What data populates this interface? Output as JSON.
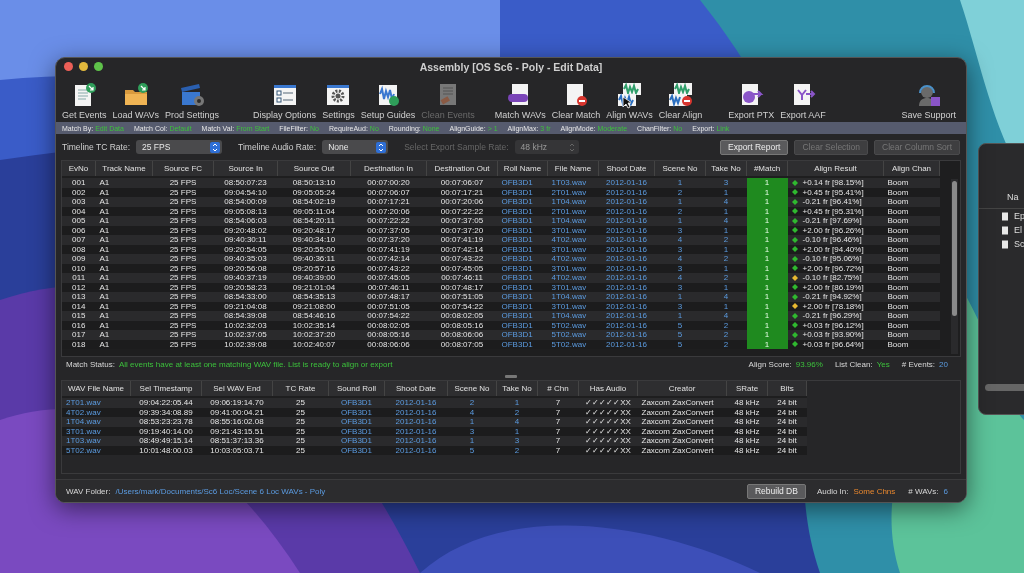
{
  "window": {
    "title": "Assembly [OS Sc6 - Poly - Edit Data]"
  },
  "toolbar": [
    {
      "label": "Get Events",
      "disabled": false
    },
    {
      "label": "Load WAVs",
      "disabled": false
    },
    {
      "label": "Prod Settings",
      "disabled": false
    },
    {
      "label": "Display Options",
      "disabled": false
    },
    {
      "label": "Settings",
      "disabled": false
    },
    {
      "label": "Setup Guides",
      "disabled": false
    },
    {
      "label": "Clean Events",
      "disabled": true
    },
    {
      "label": "Match WAVs",
      "disabled": false
    },
    {
      "label": "Clear Match",
      "disabled": false
    },
    {
      "label": "Align WAVs",
      "disabled": false
    },
    {
      "label": "Clear Align",
      "disabled": false
    },
    {
      "label": "Export PTX",
      "disabled": false
    },
    {
      "label": "Export AAF",
      "disabled": false
    },
    {
      "label": "Save Support",
      "disabled": false
    }
  ],
  "settings_bar": [
    {
      "label": "Match By:",
      "value": "Edit Data"
    },
    {
      "label": "Match Col:",
      "value": "Default"
    },
    {
      "label": "Match Val:",
      "value": "From Start"
    },
    {
      "label": "FileFilter:",
      "value": "No"
    },
    {
      "label": "RequireAud:",
      "value": "No"
    },
    {
      "label": "Rounding:",
      "value": "None"
    },
    {
      "label": "AlignGuide:",
      "value": "> 1"
    },
    {
      "label": "AlignMax:",
      "value": "3 fr"
    },
    {
      "label": "AlignMode:",
      "value": "Moderate"
    },
    {
      "label": "ChanFilter:",
      "value": "No"
    },
    {
      "label": "Export:",
      "value": "Link"
    }
  ],
  "selects": [
    {
      "label": "Timeline TC Rate:",
      "value": "25 FPS",
      "disabled": false
    },
    {
      "label": "Timeline Audio Rate:",
      "value": "None",
      "disabled": false
    },
    {
      "label": "Select Export Sample Rate:",
      "value": "48 kHz",
      "disabled": true
    }
  ],
  "buttons": [
    {
      "label": "Export Report",
      "disabled": false
    },
    {
      "label": "Clear Selection",
      "disabled": true
    },
    {
      "label": "Clear Column Sort",
      "disabled": true
    }
  ],
  "events_table": {
    "columns": [
      {
        "label": "EvNo",
        "kind": "center"
      },
      {
        "label": "Track Name",
        "kind": "text"
      },
      {
        "label": "Source FC",
        "kind": "center"
      },
      {
        "label": "Source In",
        "kind": "center"
      },
      {
        "label": "Source Out",
        "kind": "center"
      },
      {
        "label": "Destination In",
        "kind": "center"
      },
      {
        "label": "Destination Out",
        "kind": "center"
      },
      {
        "label": "Roll Name",
        "kind": "link"
      },
      {
        "label": "File Name",
        "kind": "link"
      },
      {
        "label": "Shoot Date",
        "kind": "link-center"
      },
      {
        "label": "Scene No",
        "kind": "link-center"
      },
      {
        "label": "Take No",
        "kind": "link-center"
      },
      {
        "label": "#Match",
        "kind": "match"
      },
      {
        "label": "Align Result",
        "kind": "result"
      },
      {
        "label": "Align Chan",
        "kind": "text"
      }
    ],
    "rows": [
      {
        "cells": [
          "001",
          "A1",
          "25 FPS",
          "08:50:07:23",
          "08:50:13:10",
          "00:07:00:20",
          "00:07:06:07",
          "OFB3D1",
          "1T03.wav",
          "2012-01-16",
          "1",
          "3",
          "1",
          "+0.14 fr [98.15%]",
          "Boom"
        ],
        "color": "#2fb82f"
      },
      {
        "cells": [
          "002",
          "A1",
          "25 FPS",
          "09:04:54:10",
          "09:05:05:24",
          "00:07:06:07",
          "00:07:17:21",
          "OFB3D1",
          "2T01.wav",
          "2012-01-16",
          "2",
          "1",
          "1",
          "+0.45 fr [95.41%]",
          "Boom"
        ],
        "color": "#2fb82f"
      },
      {
        "cells": [
          "003",
          "A1",
          "25 FPS",
          "08:54:00:09",
          "08:54:02:19",
          "00:07:17:21",
          "00:07:20:06",
          "OFB3D1",
          "1T04.wav",
          "2012-01-16",
          "1",
          "4",
          "1",
          "-0.21 fr [96.41%]",
          "Boom"
        ],
        "color": "#2fb82f"
      },
      {
        "cells": [
          "004",
          "A1",
          "25 FPS",
          "09:05:08:13",
          "09:05:11:04",
          "00:07:20:06",
          "00:07:22:22",
          "OFB3D1",
          "2T01.wav",
          "2012-01-16",
          "2",
          "1",
          "1",
          "+0.45 fr [95.31%]",
          "Boom"
        ],
        "color": "#2fb82f"
      },
      {
        "cells": [
          "005",
          "A1",
          "25 FPS",
          "08:54:06:03",
          "08:54:20:11",
          "00:07:22:22",
          "00:07:37:05",
          "OFB3D1",
          "1T04.wav",
          "2012-01-16",
          "1",
          "4",
          "1",
          "-0.21 fr [97.69%]",
          "Boom"
        ],
        "color": "#2fb82f"
      },
      {
        "cells": [
          "006",
          "A1",
          "25 FPS",
          "09:20:48:02",
          "09:20:48:17",
          "00:07:37:05",
          "00:07:37:20",
          "OFB3D1",
          "3T01.wav",
          "2012-01-16",
          "3",
          "1",
          "1",
          "+2.00 fr [96.26%]",
          "Boom"
        ],
        "color": "#2fb82f"
      },
      {
        "cells": [
          "007",
          "A1",
          "25 FPS",
          "09:40:30:11",
          "09:40:34:10",
          "00:07:37:20",
          "00:07:41:19",
          "OFB3D1",
          "4T02.wav",
          "2012-01-16",
          "4",
          "2",
          "1",
          "-0.10 fr [96.46%]",
          "Boom"
        ],
        "color": "#2fb82f"
      },
      {
        "cells": [
          "008",
          "A1",
          "25 FPS",
          "09:20:54:05",
          "09:20:55:00",
          "00:07:41:19",
          "00:07:42:14",
          "OFB3D1",
          "3T01.wav",
          "2012-01-16",
          "3",
          "1",
          "1",
          "+2.00 fr [94.40%]",
          "Boom"
        ],
        "color": "#2fb82f"
      },
      {
        "cells": [
          "009",
          "A1",
          "25 FPS",
          "09:40:35:03",
          "09:40:36:11",
          "00:07:42:14",
          "00:07:43:22",
          "OFB3D1",
          "4T02.wav",
          "2012-01-16",
          "4",
          "2",
          "1",
          "-0.10 fr [95.06%]",
          "Boom"
        ],
        "color": "#2fb82f"
      },
      {
        "cells": [
          "010",
          "A1",
          "25 FPS",
          "09:20:56:08",
          "09:20:57:16",
          "00:07:43:22",
          "00:07:45:05",
          "OFB3D1",
          "3T01.wav",
          "2012-01-16",
          "3",
          "1",
          "1",
          "+2.00 fr [96.72%]",
          "Boom"
        ],
        "color": "#2fb82f"
      },
      {
        "cells": [
          "011",
          "A1",
          "25 FPS",
          "09:40:37:19",
          "09:40:39:00",
          "00:07:45:05",
          "00:07:46:11",
          "OFB3D1",
          "4T02.wav",
          "2012-01-16",
          "4",
          "2",
          "1",
          "-0.10 fr [82.75%]",
          "Boom"
        ],
        "color": "#e8b830"
      },
      {
        "cells": [
          "012",
          "A1",
          "25 FPS",
          "09:20:58:23",
          "09:21:01:04",
          "00:07:46:11",
          "00:07:48:17",
          "OFB3D1",
          "3T01.wav",
          "2012-01-16",
          "3",
          "1",
          "1",
          "+2.00 fr [86.19%]",
          "Boom"
        ],
        "color": "#2fb82f"
      },
      {
        "cells": [
          "013",
          "A1",
          "25 FPS",
          "08:54:33:00",
          "08:54:35:13",
          "00:07:48:17",
          "00:07:51:05",
          "OFB3D1",
          "1T04.wav",
          "2012-01-16",
          "1",
          "4",
          "1",
          "-0.21 fr [94.92%]",
          "Boom"
        ],
        "color": "#2fb82f"
      },
      {
        "cells": [
          "014",
          "A1",
          "25 FPS",
          "09:21:04:08",
          "09:21:08:00",
          "00:07:51:05",
          "00:07:54:22",
          "OFB3D1",
          "3T01.wav",
          "2012-01-16",
          "3",
          "1",
          "1",
          "+2.00 fr [78.18%]",
          "Boom"
        ],
        "color": "#e8b830"
      },
      {
        "cells": [
          "015",
          "A1",
          "25 FPS",
          "08:54:39:08",
          "08:54:46:16",
          "00:07:54:22",
          "00:08:02:05",
          "OFB3D1",
          "1T04.wav",
          "2012-01-16",
          "1",
          "4",
          "1",
          "-0.21 fr [96.29%]",
          "Boom"
        ],
        "color": "#2fb82f"
      },
      {
        "cells": [
          "016",
          "A1",
          "25 FPS",
          "10:02:32:03",
          "10:02:35:14",
          "00:08:02:05",
          "00:08:05:16",
          "OFB3D1",
          "5T02.wav",
          "2012-01-16",
          "5",
          "2",
          "1",
          "+0.03 fr [96.12%]",
          "Boom"
        ],
        "color": "#2fb82f"
      },
      {
        "cells": [
          "017",
          "A1",
          "25 FPS",
          "10:02:37:05",
          "10:02:37:20",
          "00:08:05:16",
          "00:08:06:06",
          "OFB3D1",
          "5T02.wav",
          "2012-01-16",
          "5",
          "2",
          "1",
          "+0.03 fr [93.90%]",
          "Boom"
        ],
        "color": "#2fb82f"
      },
      {
        "cells": [
          "018",
          "A1",
          "25 FPS",
          "10:02:39:08",
          "10:02:40:07",
          "00:08:06:06",
          "00:08:07:05",
          "OFB3D1",
          "5T02.wav",
          "2012-01-16",
          "5",
          "2",
          "1",
          "+0.03 fr [96.64%]",
          "Boom"
        ],
        "color": "#2fb82f"
      }
    ]
  },
  "match_status": {
    "label": "Match Status:",
    "message": "All events have at least one matching WAV file. List is ready to align or export"
  },
  "summary": [
    {
      "label": "Align Score:",
      "value": "93.96%",
      "kind": "good"
    },
    {
      "label": "List Clean:",
      "value": "Yes",
      "kind": "good"
    },
    {
      "label": "# Events:",
      "value": "20",
      "kind": "info"
    }
  ],
  "wav_table": {
    "columns": [
      {
        "label": "WAV File Name",
        "kind": "link"
      },
      {
        "label": "Sel Timestamp",
        "kind": "center"
      },
      {
        "label": "Sel WAV End",
        "kind": "center"
      },
      {
        "label": "TC Rate",
        "kind": "center"
      },
      {
        "label": "Sound Roll",
        "kind": "link-center"
      },
      {
        "label": "Shoot Date",
        "kind": "link-center"
      },
      {
        "label": "Scene No",
        "kind": "link-center"
      },
      {
        "label": "Take No",
        "kind": "link-center"
      },
      {
        "label": "# Chn",
        "kind": "center"
      },
      {
        "label": "Has Audio",
        "kind": "center"
      },
      {
        "label": "Creator",
        "kind": "text"
      },
      {
        "label": "SRate",
        "kind": "center"
      },
      {
        "label": "Bits",
        "kind": "center"
      }
    ],
    "rows": [
      [
        "2T01.wav",
        "09:04:22:05.44",
        "09:06:19:14.70",
        "25",
        "OFB3D1",
        "2012-01-16",
        "2",
        "1",
        "7",
        "✓✓✓✓✓XX",
        "Zaxcom ZaxConvert",
        "48 kHz",
        "24 bit"
      ],
      [
        "4T02.wav",
        "09:39:34:08.89",
        "09:41:00:04.21",
        "25",
        "OFB3D1",
        "2012-01-16",
        "4",
        "2",
        "7",
        "✓✓✓✓✓XX",
        "Zaxcom ZaxConvert",
        "48 kHz",
        "24 bit"
      ],
      [
        "1T04.wav",
        "08:53:23:23.78",
        "08:55:16:02.08",
        "25",
        "OFB3D1",
        "2012-01-16",
        "1",
        "4",
        "7",
        "✓✓✓✓✓XX",
        "Zaxcom ZaxConvert",
        "48 kHz",
        "24 bit"
      ],
      [
        "3T01.wav",
        "09:19:40:14.00",
        "09:21:43:15.51",
        "25",
        "OFB3D1",
        "2012-01-16",
        "3",
        "1",
        "7",
        "✓✓✓✓✓XX",
        "Zaxcom ZaxConvert",
        "48 kHz",
        "24 bit"
      ],
      [
        "1T03.wav",
        "08:49:49:15.14",
        "08:51:37:13.36",
        "25",
        "OFB3D1",
        "2012-01-16",
        "1",
        "3",
        "7",
        "✓✓✓✓✓XX",
        "Zaxcom ZaxConvert",
        "48 kHz",
        "24 bit"
      ],
      [
        "5T02.wav",
        "10:01:48:00.03",
        "10:03:05:03.71",
        "25",
        "OFB3D1",
        "2012-01-16",
        "5",
        "2",
        "7",
        "✓✓✓✓✓XX",
        "Zaxcom ZaxConvert",
        "48 kHz",
        "24 bit"
      ]
    ]
  },
  "footer": {
    "folder_label": "WAV Folder:",
    "folder_path": "/Users/mark/Documents/Sc6 Loc/Scene 6 Loc WAVs - Poly",
    "button": "Rebuild DB",
    "stats": [
      {
        "label": "Audio In:",
        "value": "Some Chns",
        "kind": "warn"
      },
      {
        "label": "# WAVs:",
        "value": "6",
        "kind": "info"
      }
    ]
  },
  "side_window": {
    "header": "Na",
    "items": [
      "Ep",
      "El",
      "Sc"
    ]
  }
}
